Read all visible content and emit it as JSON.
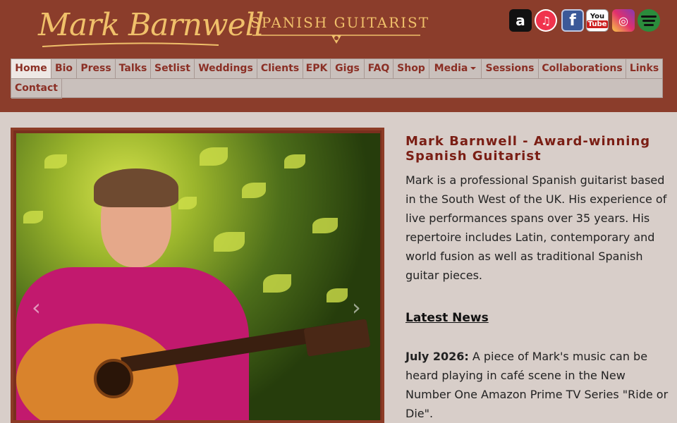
{
  "header": {
    "logo_name": "Mark Barnwell",
    "logo_subtitle": "SPANISH GUITARIST",
    "accent_color": "#f0c06a",
    "background_color": "#8b3d2b"
  },
  "social": [
    {
      "name": "amazon-icon",
      "glyph": "a"
    },
    {
      "name": "apple-music-icon",
      "glyph": "♫"
    },
    {
      "name": "facebook-icon",
      "glyph": "f"
    },
    {
      "name": "youtube-icon",
      "glyph_top": "You",
      "glyph_bottom": "Tube"
    },
    {
      "name": "instagram-icon",
      "glyph": "◎"
    },
    {
      "name": "spotify-icon"
    }
  ],
  "nav": {
    "items": [
      {
        "label": "Home",
        "active": true
      },
      {
        "label": "Bio"
      },
      {
        "label": "Press"
      },
      {
        "label": "Talks"
      },
      {
        "label": "Setlist"
      },
      {
        "label": "Weddings"
      },
      {
        "label": "Clients"
      },
      {
        "label": "EPK"
      },
      {
        "label": "Gigs"
      },
      {
        "label": "FAQ"
      },
      {
        "label": "Shop"
      },
      {
        "label": "Media",
        "dropdown": true
      },
      {
        "label": "Sessions"
      },
      {
        "label": "Collaborations"
      },
      {
        "label": "Links"
      },
      {
        "label": "Contact"
      }
    ]
  },
  "carousel": {
    "prev_glyph": "‹",
    "next_glyph": "›"
  },
  "main": {
    "headline": "Mark Barnwell - Award-winning Spanish Guitarist",
    "intro": "Mark is a professional Spanish guitarist based in the South West of the UK. His experience of live performances spans over 35 years. His repertoire includes Latin, contemporary and world fusion as well as traditional Spanish guitar pieces.",
    "news_heading": "Latest News",
    "news": {
      "date": "July 2026:",
      "text": " A piece of Mark's music can be heard playing in café scene in the New Number One Amazon Prime TV Series \"Ride or Die\"."
    }
  }
}
